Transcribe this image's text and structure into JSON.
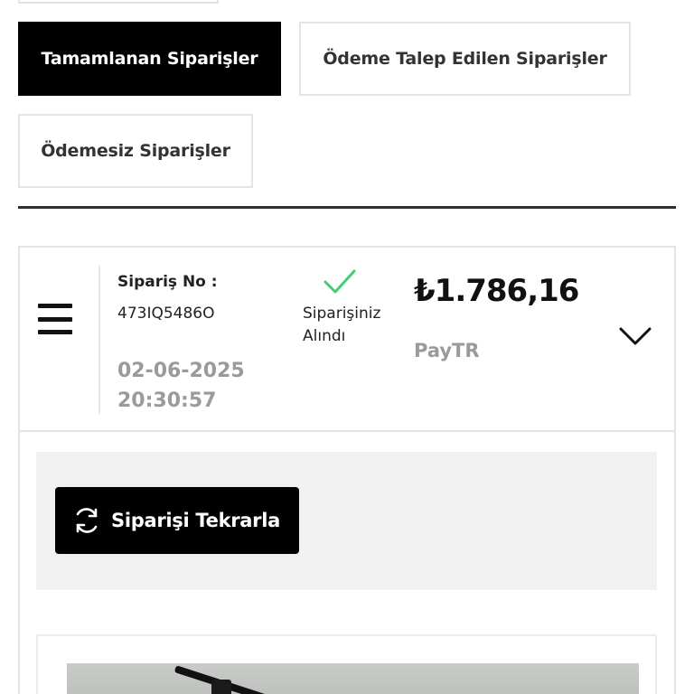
{
  "tabs": [
    {
      "label": "Tamamlanan Siparişler",
      "active": true
    },
    {
      "label": "Ödeme Talep Edilen Siparişler",
      "active": false
    },
    {
      "label": "Ödemesiz Siparişler",
      "active": false
    }
  ],
  "order": {
    "number_label": "Sipariş No :",
    "number_value": "473IQ5486O",
    "date": "02-06-2025",
    "time": "20:30:57",
    "status_line1": "Siparişiniz",
    "status_line2": "Alındı",
    "amount": "₺1.786,16",
    "gateway": "PayTR"
  },
  "actions": {
    "repeat_label": "Siparişi Tekrarla"
  },
  "icons": {
    "menu": "hamburger-menu-icon",
    "status": "checkmark-icon",
    "expand": "chevron-down-icon",
    "repeat": "refresh-icon"
  },
  "colors": {
    "active_tab_bg": "#000000",
    "check_green": "#3ecf6e",
    "muted_text": "#9a9a9a",
    "panel_bg": "#f1f1f1"
  }
}
